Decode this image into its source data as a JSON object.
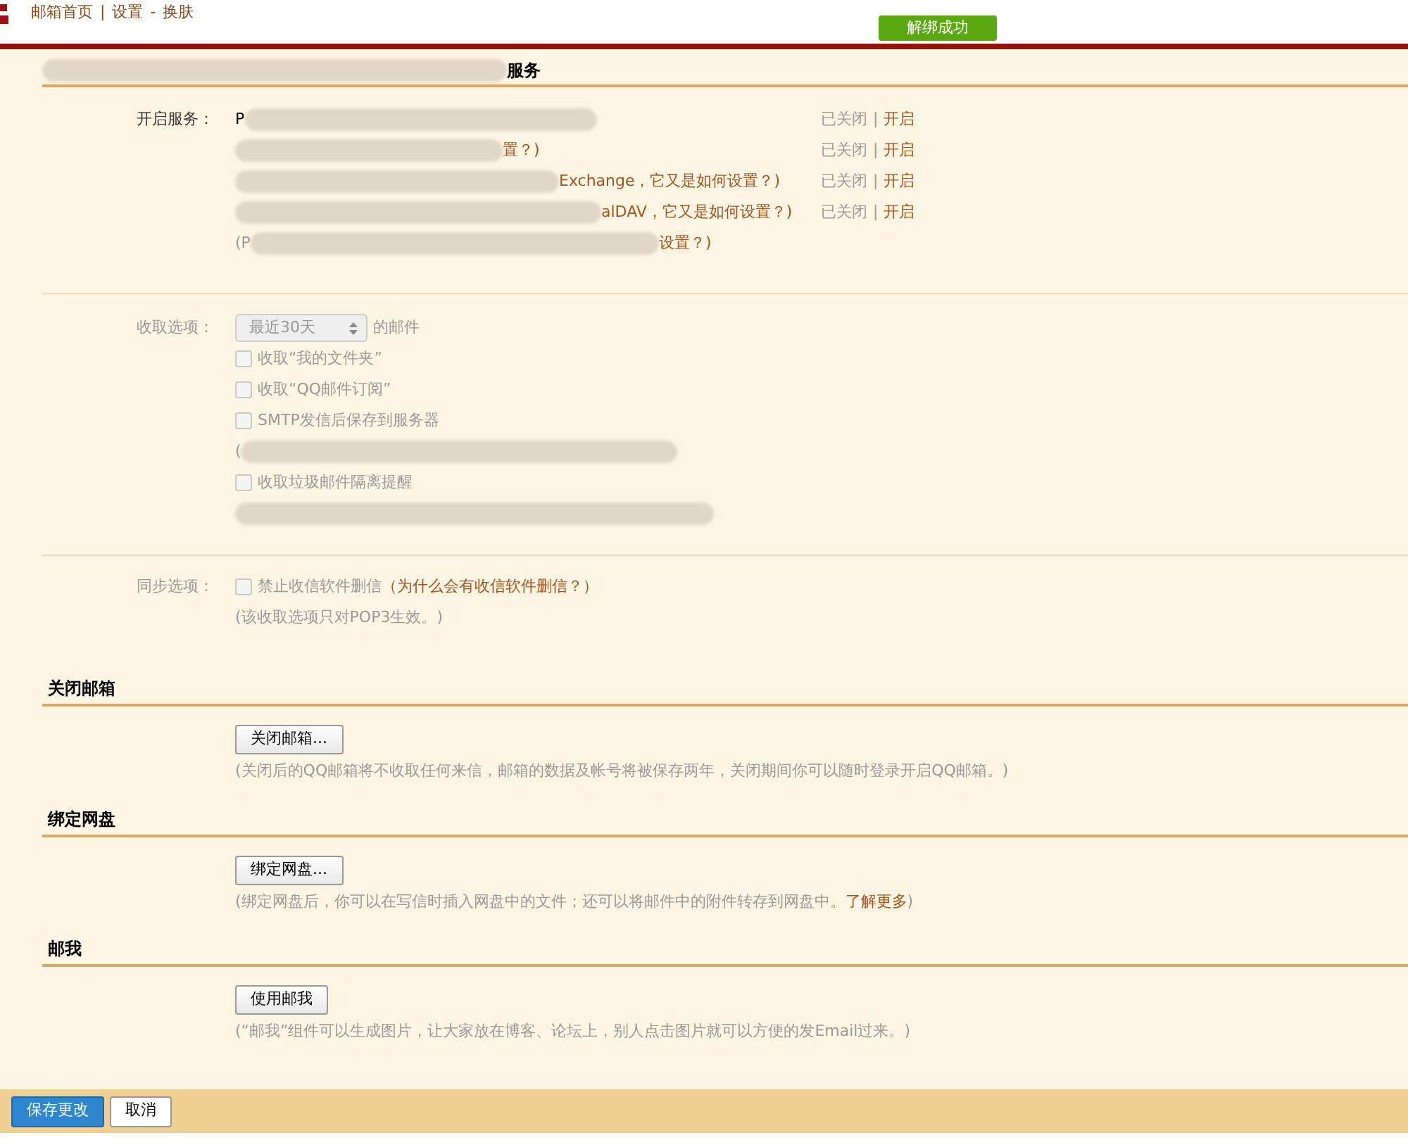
{
  "header": {
    "nav": [
      "邮箱首页",
      "|",
      "设置",
      "-",
      "换肤"
    ],
    "notice": "解绑成功"
  },
  "service": {
    "title_tail": "服务",
    "label": "开启服务：",
    "rows": [
      {
        "lead": "P",
        "tail": "",
        "status": "已关闭",
        "sep": "|",
        "action": "开启"
      },
      {
        "lead": "",
        "tail": "置？)",
        "status": "已关闭",
        "sep": "|",
        "action": "开启"
      },
      {
        "lead": "",
        "tail": "Exchange，它又是如何设置？)",
        "status": "已关闭",
        "sep": "|",
        "action": "开启"
      },
      {
        "lead": "",
        "tail": "alDAV，它又是如何设置？)",
        "status": "已关闭",
        "sep": "|",
        "action": "开启"
      }
    ],
    "note": {
      "lead": "(P",
      "tail": "设置？)"
    }
  },
  "receive": {
    "label": "收取选项：",
    "select": "最近30天",
    "suffix": "的邮件",
    "items": [
      {
        "kind": "checkbox",
        "label": "收取“我的文件夹”",
        "checked": false
      },
      {
        "kind": "checkbox",
        "label": "收取“QQ邮件订阅”",
        "checked": false
      },
      {
        "kind": "checkbox",
        "label": "SMTP发信后保存到服务器",
        "checked": false
      },
      {
        "kind": "note",
        "lead": "("
      },
      {
        "kind": "checkbox",
        "label": "收取垃圾邮件隔离提醒",
        "checked": false
      },
      {
        "kind": "blur"
      }
    ]
  },
  "sync": {
    "label": "同步选项：",
    "checkbox": {
      "label": "禁止收信软件删信",
      "checked": false
    },
    "link": "（为什么会有收信软件删信？）",
    "note": "(该收取选项只对POP3生效。)"
  },
  "sections": [
    {
      "title": "关闭邮箱",
      "button": "关闭邮箱...",
      "note": "(关闭后的QQ邮箱将不收取任何来信，邮箱的数据及帐号将被保存两年，关闭期间你可以随时登录开启QQ邮箱。)"
    },
    {
      "title": "绑定网盘",
      "button": "绑定网盘...",
      "note": "(绑定网盘后，你可以在写信时插入网盘中的文件；还可以将邮件中的附件转存到网盘中。",
      "link": "了解更多",
      "tail": ")"
    },
    {
      "title": "邮我",
      "button": "使用邮我",
      "note": "(“邮我”组件可以生成图片，让大家放在博客、论坛上，别人点击图片就可以方便的发Email过来。)"
    }
  ],
  "footer": {
    "save": "保存更改",
    "cancel": "取消"
  }
}
